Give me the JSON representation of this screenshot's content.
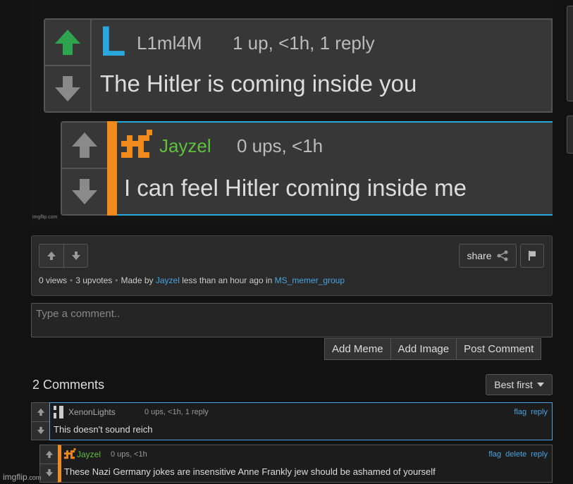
{
  "meme": {
    "watermark_small": "imgflip.com",
    "comment1": {
      "avatar_letter": "L",
      "username": "L1ml4M",
      "meta": "1 up, <1h, 1 reply",
      "text": "The Hitler is coming inside you",
      "upvote_color": "#2ea44f",
      "avatar_color": "#29a8e0"
    },
    "comment2": {
      "username": "Jayzel",
      "meta": "0 ups, <1h",
      "text": "I can feel Hitler coming inside me",
      "username_color": "#5fbf3f",
      "reply_bar_color": "#f08a1c",
      "border_color": "#29a8e0"
    }
  },
  "panel": {
    "share_label": "share",
    "views": "0 views",
    "upvotes": "3 upvotes",
    "made_by": "Made by",
    "author": "Jayzel",
    "time": "less than an hour ago in",
    "stream": "MS_memer_group"
  },
  "comment_box": {
    "placeholder": "Type a comment..",
    "add_meme": "Add Meme",
    "add_image": "Add Image",
    "post_comment": "Post Comment"
  },
  "comments": {
    "title": "2 Comments",
    "sort_label": "Best first",
    "items": [
      {
        "username": "XenonLights",
        "meta": "0 ups, <1h, 1 reply",
        "text": "This doesn't sound reich",
        "flag": "flag",
        "reply": "reply"
      },
      {
        "username": "Jayzel",
        "meta": "0 ups, <1h",
        "text": "These Nazi Germany jokes are insensitive Anne Frankly jew should be ashamed of yourself",
        "flag": "flag",
        "delete": "delete",
        "reply": "reply"
      }
    ]
  },
  "watermark": {
    "brand": "imgflip",
    "tld": ".com"
  },
  "colors": {
    "accent": "#4aa3df",
    "orange": "#f08a1c",
    "green": "#5fbf3f"
  }
}
